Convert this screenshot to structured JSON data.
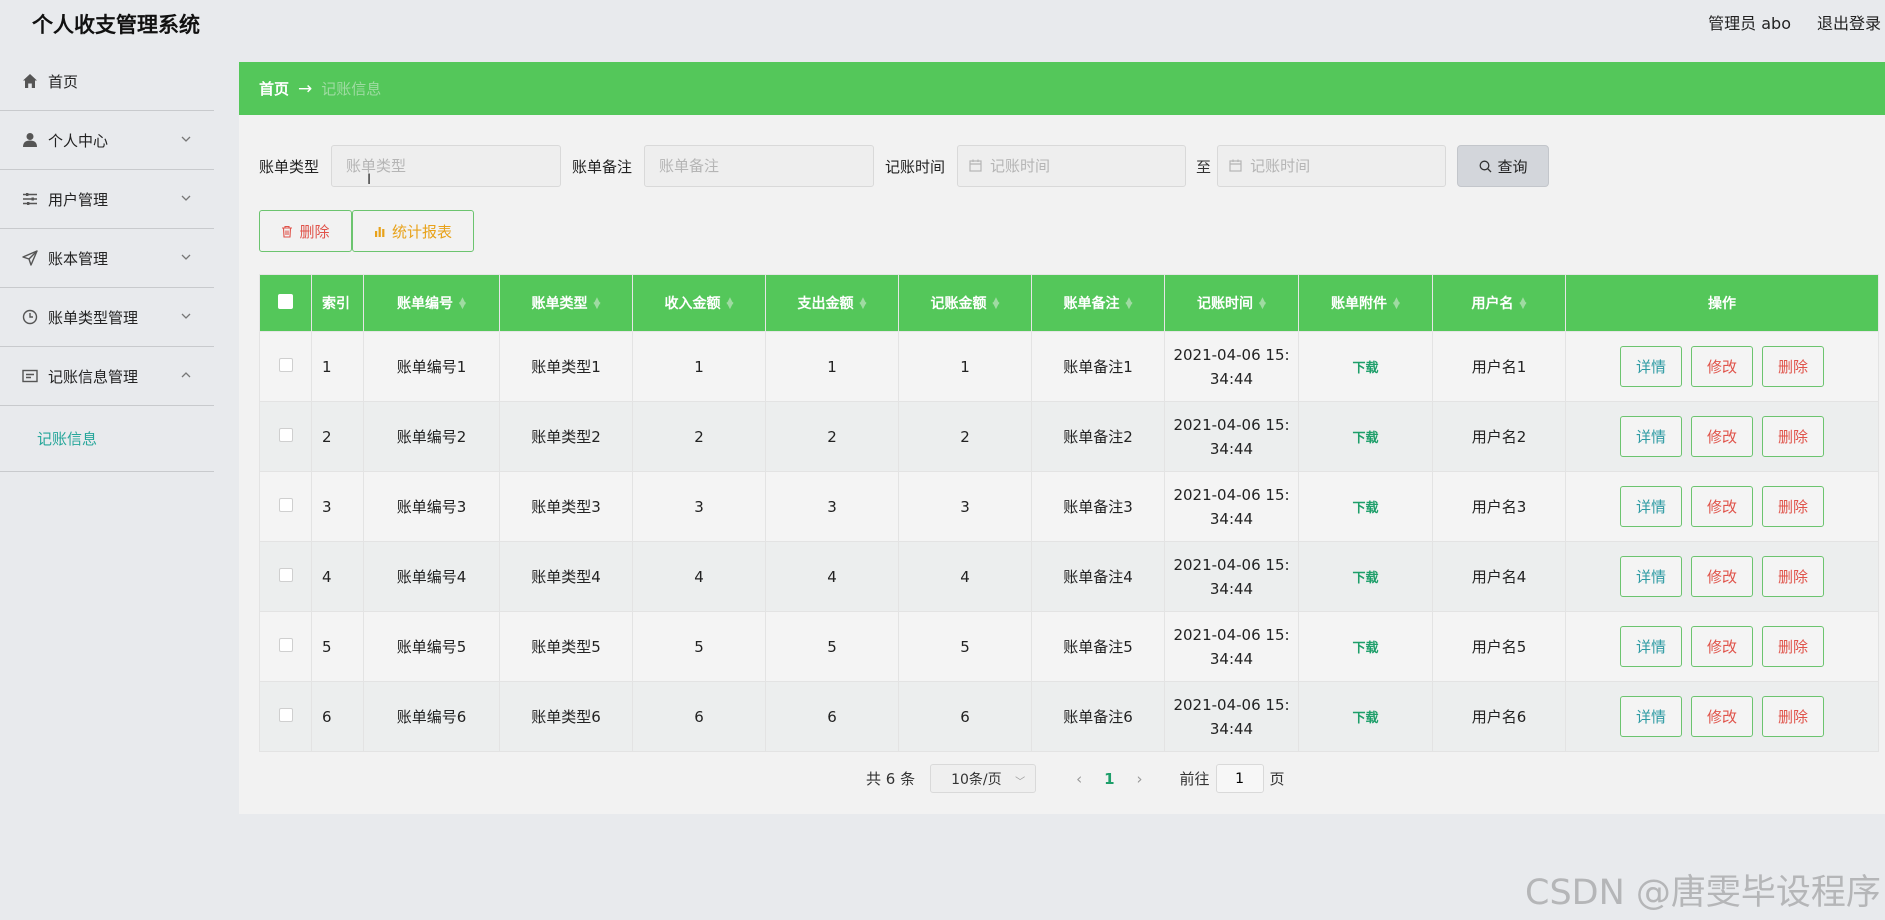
{
  "app": {
    "title": "个人收支管理系统",
    "user_label": "管理员 abo",
    "logout_label": "退出登录"
  },
  "sidebar": {
    "items": [
      {
        "label": "首页",
        "icon": "home-icon"
      },
      {
        "label": "个人中心",
        "icon": "user-icon"
      },
      {
        "label": "用户管理",
        "icon": "sliders-icon"
      },
      {
        "label": "账本管理",
        "icon": "send-icon"
      },
      {
        "label": "账单类型管理",
        "icon": "clock-icon"
      },
      {
        "label": "记账信息管理",
        "icon": "card-icon"
      }
    ],
    "sub_item": "记账信息"
  },
  "breadcrumb": {
    "home": "首页",
    "arrow": "→",
    "current": "记账信息"
  },
  "search": {
    "type_label": "账单类型",
    "type_placeholder": "账单类型",
    "note_label": "账单备注",
    "note_placeholder": "账单备注",
    "time_label": "记账时间",
    "time_start_placeholder": "记账时间",
    "to_label": "至",
    "time_end_placeholder": "记账时间",
    "query_button": "查询"
  },
  "actions": {
    "delete_button": "删除",
    "report_button": "统计报表"
  },
  "table": {
    "headers": [
      "索引",
      "账单编号",
      "账单类型",
      "收入金额",
      "支出金额",
      "记账金额",
      "账单备注",
      "记账时间",
      "账单附件",
      "用户名",
      "操作"
    ],
    "rows": [
      {
        "idx": "1",
        "no": "账单编号1",
        "type": "账单类型1",
        "income": "1",
        "expense": "1",
        "amount": "1",
        "note": "账单备注1",
        "time1": "2021-04-06 15:",
        "time2": "34:44",
        "file": "下载",
        "user": "用户名1"
      },
      {
        "idx": "2",
        "no": "账单编号2",
        "type": "账单类型2",
        "income": "2",
        "expense": "2",
        "amount": "2",
        "note": "账单备注2",
        "time1": "2021-04-06 15:",
        "time2": "34:44",
        "file": "下载",
        "user": "用户名2"
      },
      {
        "idx": "3",
        "no": "账单编号3",
        "type": "账单类型3",
        "income": "3",
        "expense": "3",
        "amount": "3",
        "note": "账单备注3",
        "time1": "2021-04-06 15:",
        "time2": "34:44",
        "file": "下载",
        "user": "用户名3"
      },
      {
        "idx": "4",
        "no": "账单编号4",
        "type": "账单类型4",
        "income": "4",
        "expense": "4",
        "amount": "4",
        "note": "账单备注4",
        "time1": "2021-04-06 15:",
        "time2": "34:44",
        "file": "下载",
        "user": "用户名4"
      },
      {
        "idx": "5",
        "no": "账单编号5",
        "type": "账单类型5",
        "income": "5",
        "expense": "5",
        "amount": "5",
        "note": "账单备注5",
        "time1": "2021-04-06 15:",
        "time2": "34:44",
        "file": "下载",
        "user": "用户名5"
      },
      {
        "idx": "6",
        "no": "账单编号6",
        "type": "账单类型6",
        "income": "6",
        "expense": "6",
        "amount": "6",
        "note": "账单备注6",
        "time1": "2021-04-06 15:",
        "time2": "34:44",
        "file": "下载",
        "user": "用户名6"
      }
    ],
    "op_labels": {
      "detail": "详情",
      "edit": "修改",
      "delete": "删除"
    }
  },
  "pagination": {
    "total": "共 6 条",
    "page_size": "10条/页",
    "current_page": "1",
    "goto_label": "前往",
    "goto_value": "1",
    "page_suffix": "页"
  },
  "watermark": "CSDN @唐雯毕设程序",
  "colors": {
    "accent_green": "#54c75a",
    "link_teal": "#26a69a",
    "danger_red": "#e0534a",
    "warning_orange": "#e8a21a"
  }
}
